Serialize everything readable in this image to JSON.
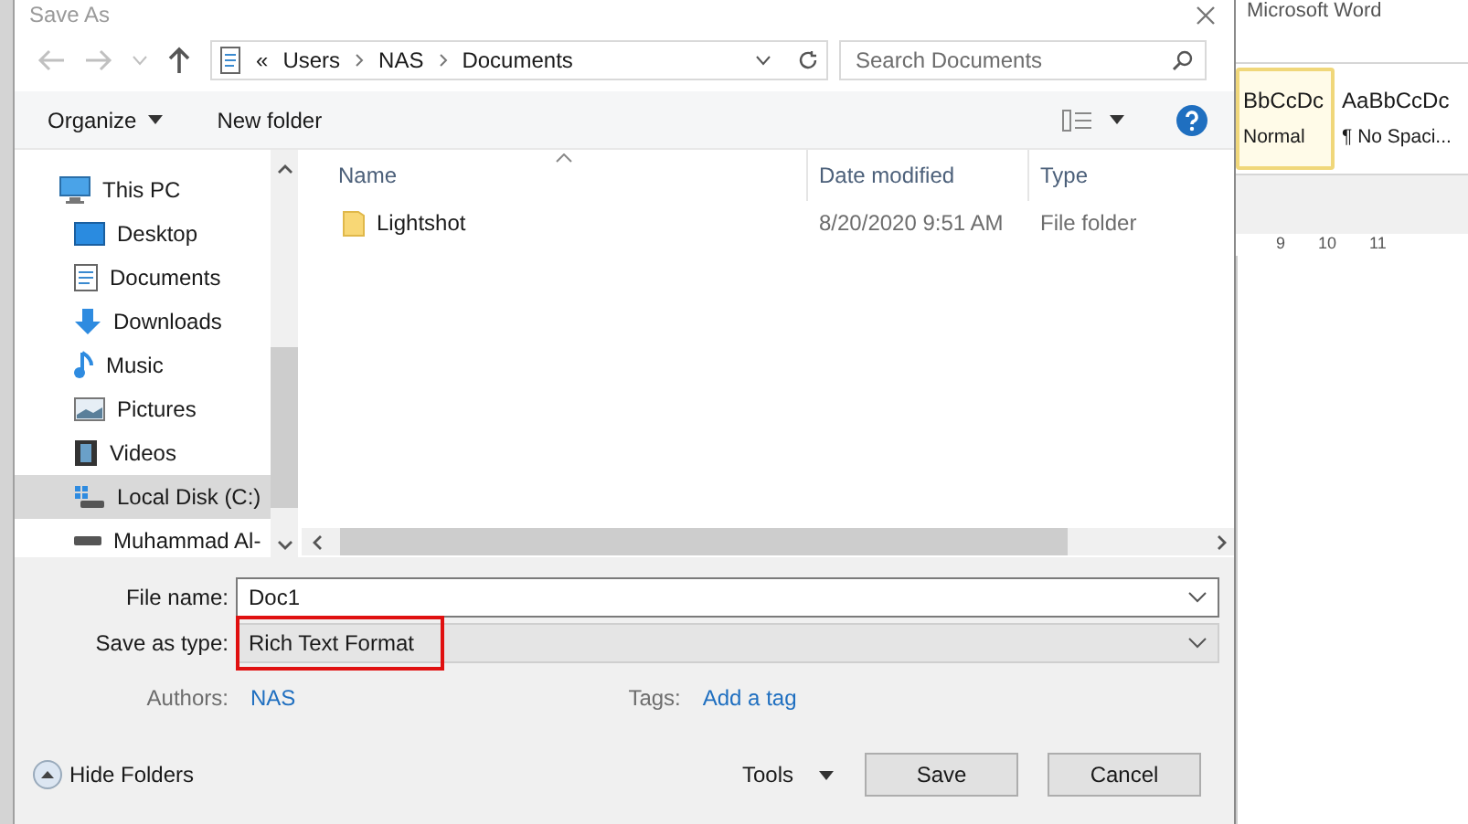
{
  "dialog": {
    "title": "Save As",
    "address": {
      "segments": [
        "«",
        "Users",
        "NAS",
        "Documents"
      ]
    },
    "search": {
      "placeholder": "Search Documents"
    },
    "toolbar": {
      "organize": "Organize",
      "new_folder": "New folder"
    },
    "nav_items": [
      {
        "label": "This PC",
        "selected": false,
        "children": [
          {
            "label": "Desktop",
            "selected": false
          },
          {
            "label": "Documents",
            "selected": false
          },
          {
            "label": "Downloads",
            "selected": false
          },
          {
            "label": "Music",
            "selected": false
          },
          {
            "label": "Pictures",
            "selected": false
          },
          {
            "label": "Videos",
            "selected": false
          },
          {
            "label": "Local Disk (C:)",
            "selected": true
          },
          {
            "label": "Muhammad Al-",
            "selected": false
          }
        ]
      }
    ],
    "columns": [
      "Name",
      "Date modified",
      "Type"
    ],
    "rows": [
      {
        "name": "Lightshot",
        "date_modified": "8/20/2020 9:51 AM",
        "type": "File folder"
      }
    ],
    "form": {
      "file_name_label": "File name:",
      "file_name": "Doc1",
      "type_label": "Save as type:",
      "save_as_type": "Rich Text Format",
      "type_highlighted": true,
      "authors_label": "Authors:",
      "authors": "NAS",
      "tags_label": "Tags:",
      "tags": "Add a tag"
    },
    "buttons": {
      "hide_folders": "Hide Folders",
      "tools": "Tools",
      "save": "Save",
      "cancel": "Cancel"
    }
  },
  "background_app": {
    "title": "Microsoft Word",
    "styles": [
      {
        "preview": "BbCcDc",
        "name": "Normal",
        "selected": true
      },
      {
        "preview": "AaBbCcDc",
        "name": "¶ No Spaci...",
        "selected": false
      }
    ],
    "ruler": [
      "9",
      "10",
      "11"
    ]
  }
}
